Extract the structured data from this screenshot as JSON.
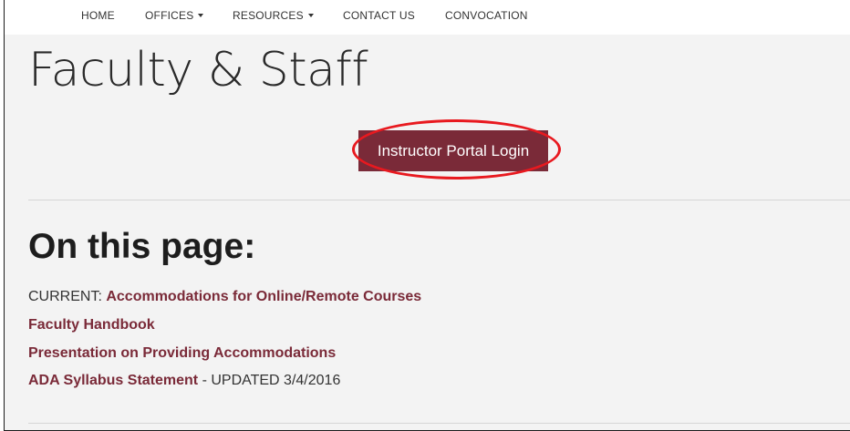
{
  "nav": {
    "items": [
      {
        "label": "HOME",
        "has_dropdown": false
      },
      {
        "label": "OFFICES",
        "has_dropdown": true
      },
      {
        "label": "RESOURCES",
        "has_dropdown": true
      },
      {
        "label": "CONTACT US",
        "has_dropdown": false
      },
      {
        "label": "CONVOCATION",
        "has_dropdown": false
      }
    ]
  },
  "page": {
    "title": "Faculty & Staff",
    "login_button": "Instructor Portal Login",
    "section_heading": "On this page:"
  },
  "toc": {
    "line1_prefix": "CURRENT: ",
    "line1_link": "Accommodations for Online/Remote Courses",
    "line2_link": "Faculty Handbook",
    "line3_link": "Presentation on Providing Accommodations",
    "line4_link": "ADA Syllabus Statement",
    "line4_suffix": " - UPDATED 3/4/2016"
  },
  "colors": {
    "brand_maroon": "#7a2a38",
    "highlight_red": "#e8191f",
    "background": "#f3f3f3"
  },
  "icons": {
    "dropdown": "caret-down-icon"
  }
}
